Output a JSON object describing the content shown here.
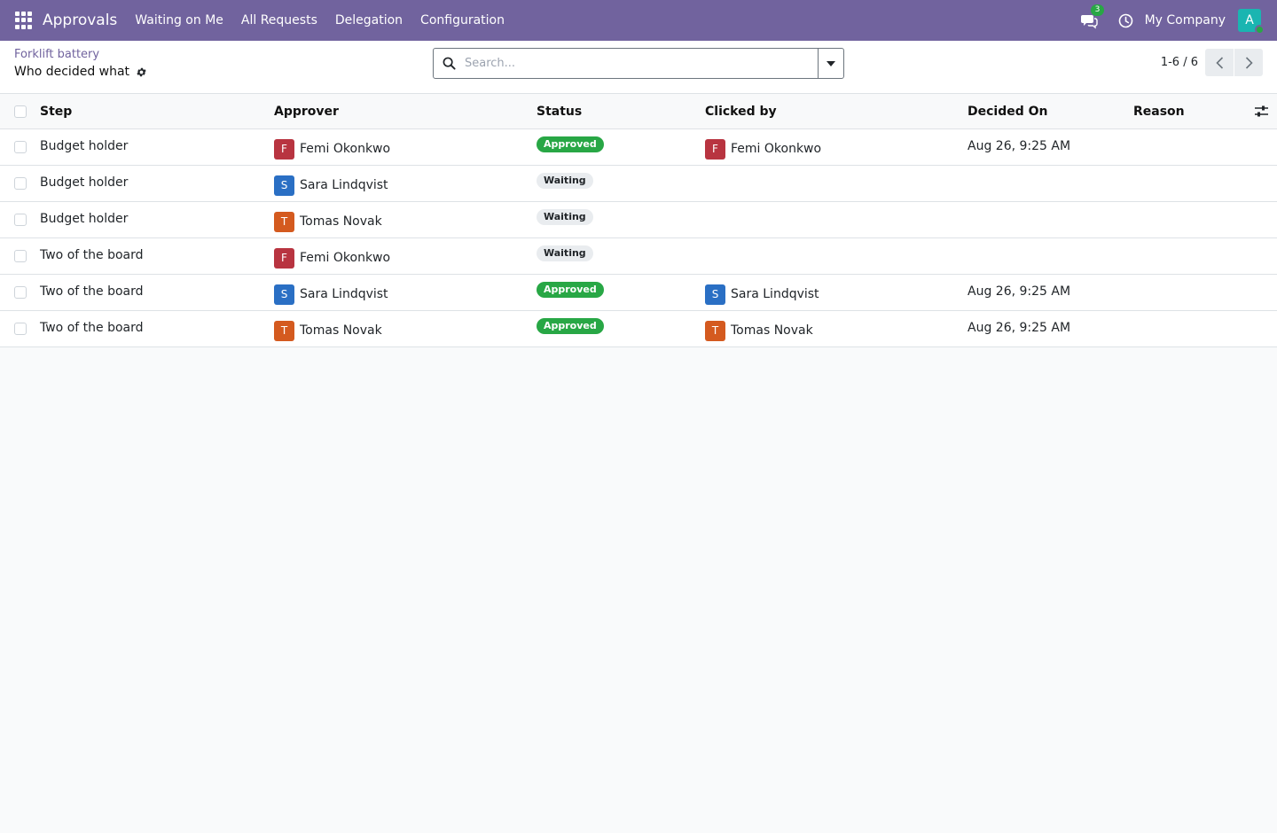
{
  "navbar": {
    "app_name": "Approvals",
    "menu": [
      "Waiting on Me",
      "All Requests",
      "Delegation",
      "Configuration"
    ],
    "chat_count": "3",
    "company": "My Company",
    "user_initial": "A"
  },
  "breadcrumb": {
    "parent": "Forklift battery",
    "current": "Who decided what"
  },
  "search": {
    "placeholder": "Search..."
  },
  "pager": {
    "value": "1-6 / 6"
  },
  "table": {
    "headers": {
      "step": "Step",
      "approver": "Approver",
      "status": "Status",
      "clicked_by": "Clicked by",
      "decided_on": "Decided On",
      "reason": "Reason"
    },
    "rows": [
      {
        "step": "Budget holder",
        "approver": "Femi Okonkwo",
        "approver_initial": "F",
        "approver_color": "#b83440",
        "status": "Approved",
        "clicked_by": "Femi Okonkwo",
        "clicked_initial": "F",
        "clicked_color": "#b83440",
        "decided_on": "Aug 26, 9:25 AM",
        "reason": ""
      },
      {
        "step": "Budget holder",
        "approver": "Sara Lindqvist",
        "approver_initial": "S",
        "approver_color": "#2a6fc4",
        "status": "Waiting",
        "clicked_by": "",
        "clicked_initial": "",
        "clicked_color": "",
        "decided_on": "",
        "reason": ""
      },
      {
        "step": "Budget holder",
        "approver": "Tomas Novak",
        "approver_initial": "T",
        "approver_color": "#d45a1f",
        "status": "Waiting",
        "clicked_by": "",
        "clicked_initial": "",
        "clicked_color": "",
        "decided_on": "",
        "reason": ""
      },
      {
        "step": "Two of the board",
        "approver": "Femi Okonkwo",
        "approver_initial": "F",
        "approver_color": "#b83440",
        "status": "Waiting",
        "clicked_by": "",
        "clicked_initial": "",
        "clicked_color": "",
        "decided_on": "",
        "reason": ""
      },
      {
        "step": "Two of the board",
        "approver": "Sara Lindqvist",
        "approver_initial": "S",
        "approver_color": "#2a6fc4",
        "status": "Approved",
        "clicked_by": "Sara Lindqvist",
        "clicked_initial": "S",
        "clicked_color": "#2a6fc4",
        "decided_on": "Aug 26, 9:25 AM",
        "reason": ""
      },
      {
        "step": "Two of the board",
        "approver": "Tomas Novak",
        "approver_initial": "T",
        "approver_color": "#d45a1f",
        "status": "Approved",
        "clicked_by": "Tomas Novak",
        "clicked_initial": "T",
        "clicked_color": "#d45a1f",
        "decided_on": "Aug 26, 9:25 AM",
        "reason": ""
      }
    ]
  },
  "colors": {
    "brand": "#71639e",
    "approved": "#28a745",
    "waiting": "#e9ecef"
  },
  "icons": {
    "apps": "apps-grid-icon",
    "chat": "chat-icon",
    "clock": "clock-icon",
    "gear": "gear-icon",
    "search": "search-icon",
    "dropdown": "caret-down-icon",
    "prev": "chevron-left-icon",
    "next": "chevron-right-icon",
    "optional_columns": "sliders-icon"
  }
}
